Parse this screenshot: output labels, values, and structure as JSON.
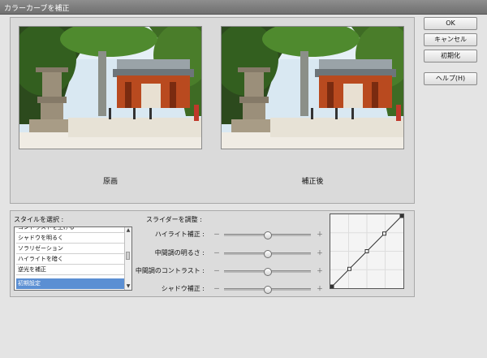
{
  "window": {
    "title": "カラーカーブを補正"
  },
  "preview": {
    "original_label": "原画",
    "corrected_label": "補正後"
  },
  "buttons": {
    "ok": "OK",
    "cancel": "キャンセル",
    "reset": "初期化",
    "help": "ヘルプ(H)"
  },
  "styles": {
    "label": "スタイルを選択 :",
    "items": [
      "コントラストを上げる",
      "シャドウを明るく",
      "ソラリゼーション",
      "ハイライトを暗く",
      "逆光を補正",
      "初期設定"
    ],
    "selected_index": 5
  },
  "sliders": {
    "label": "スライダーを調整 :",
    "minus": "－",
    "plus": "＋",
    "items": [
      {
        "label": "ハイライト補正 :",
        "value": 0.5
      },
      {
        "label": "中間調の明るさ :",
        "value": 0.5
      },
      {
        "label": "中間調のコントラスト :",
        "value": 0.5
      },
      {
        "label": "シャドウ補正 :",
        "value": 0.5
      }
    ]
  },
  "curve": {
    "points": [
      [
        0,
        0
      ],
      [
        0.25,
        0.25
      ],
      [
        0.5,
        0.5
      ],
      [
        0.75,
        0.75
      ],
      [
        1,
        1
      ]
    ]
  },
  "colors": {
    "selection": "#5b8fd3",
    "titlebar": "#7a7a7a"
  }
}
